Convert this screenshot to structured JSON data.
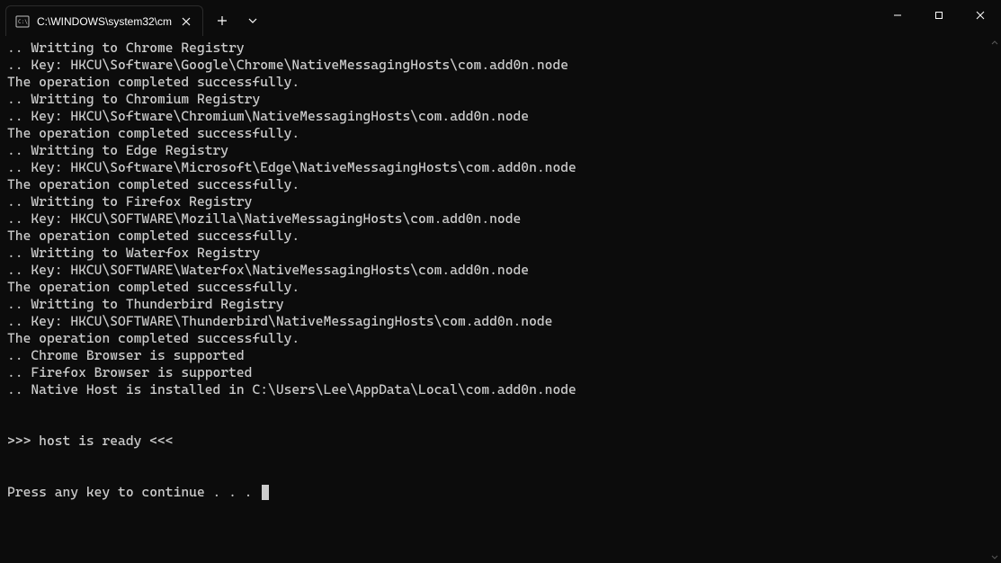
{
  "window": {
    "tab_title": "C:\\WINDOWS\\system32\\cm"
  },
  "terminal": {
    "lines": [
      ".. Writting to Chrome Registry",
      ".. Key: HKCU\\Software\\Google\\Chrome\\NativeMessagingHosts\\com.add0n.node",
      "The operation completed successfully.",
      ".. Writting to Chromium Registry",
      ".. Key: HKCU\\Software\\Chromium\\NativeMessagingHosts\\com.add0n.node",
      "The operation completed successfully.",
      ".. Writting to Edge Registry",
      ".. Key: HKCU\\Software\\Microsoft\\Edge\\NativeMessagingHosts\\com.add0n.node",
      "The operation completed successfully.",
      ".. Writting to Firefox Registry",
      ".. Key: HKCU\\SOFTWARE\\Mozilla\\NativeMessagingHosts\\com.add0n.node",
      "The operation completed successfully.",
      ".. Writting to Waterfox Registry",
      ".. Key: HKCU\\SOFTWARE\\Waterfox\\NativeMessagingHosts\\com.add0n.node",
      "The operation completed successfully.",
      ".. Writting to Thunderbird Registry",
      ".. Key: HKCU\\SOFTWARE\\Thunderbird\\NativeMessagingHosts\\com.add0n.node",
      "The operation completed successfully.",
      ".. Chrome Browser is supported",
      ".. Firefox Browser is supported",
      ".. Native Host is installed in C:\\Users\\Lee\\AppData\\Local\\com.add0n.node",
      "",
      "",
      ">>> host is ready <<<",
      "",
      "",
      "Press any key to continue . . . "
    ]
  }
}
